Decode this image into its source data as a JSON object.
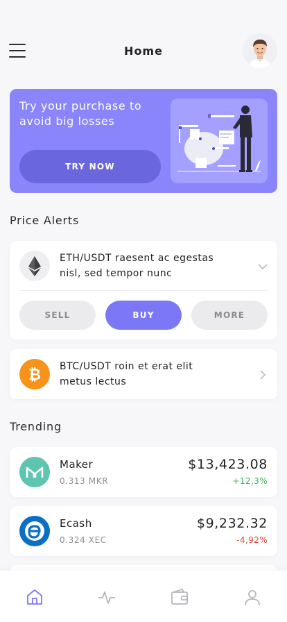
{
  "header": {
    "title": "Home",
    "menu_icon": "hamburger-menu-icon",
    "avatar_icon": "user-avatar"
  },
  "promo": {
    "text": "Try your purchase to avoid big losses",
    "button_label": "TRY NOW",
    "color": "#8a85fb"
  },
  "price_alerts": {
    "title": "Price Alerts",
    "items": [
      {
        "icon": "ethereum-icon",
        "text_line1": "ETH/USDT raesent ac egestas",
        "text_line2": "nisl, sed tempor nunc",
        "expanded": true
      },
      {
        "icon": "bitcoin-icon",
        "text_line1": "BTC/USDT roin et erat elit",
        "text_line2": "metus lectus",
        "expanded": false
      }
    ],
    "actions": {
      "sell": "SELL",
      "buy": "BUY",
      "more": "MORE"
    }
  },
  "trending": {
    "title": "Trending",
    "items": [
      {
        "name": "Maker",
        "amount": "0.313 MKR",
        "price": "$13,423.08",
        "change": "+12,3%",
        "change_color": "#3fae5a",
        "icon": "maker-icon"
      },
      {
        "name": "Ecash",
        "amount": "0.324 XEC",
        "price": "$9,232.32",
        "change": "-4,92%",
        "change_color": "#e0443a",
        "icon": "ecash-icon"
      }
    ]
  },
  "tabs": [
    {
      "name": "home",
      "icon": "home-icon",
      "active": true
    },
    {
      "name": "activity",
      "icon": "activity-icon",
      "active": false
    },
    {
      "name": "wallet",
      "icon": "wallet-icon",
      "active": false
    },
    {
      "name": "profile",
      "icon": "profile-icon",
      "active": false
    }
  ]
}
